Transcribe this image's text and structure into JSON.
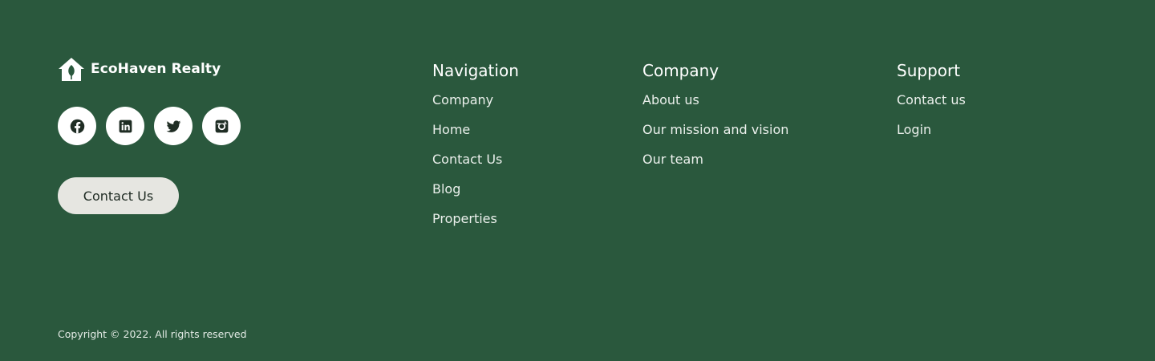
{
  "brand": {
    "name": "EcoHaven Realty",
    "logo_icon": "house-leaf-icon"
  },
  "social": [
    {
      "icon": "facebook-icon"
    },
    {
      "icon": "linkedin-icon"
    },
    {
      "icon": "twitter-icon"
    },
    {
      "icon": "instagram-icon"
    }
  ],
  "cta": {
    "label": "Contact Us"
  },
  "columns": {
    "navigation": {
      "title": "Navigation",
      "links": [
        "Company",
        "Home",
        "Contact Us",
        "Blog",
        "Properties"
      ]
    },
    "company": {
      "title": "Company",
      "links": [
        "About us",
        "Our mission and vision",
        "Our team"
      ]
    },
    "support": {
      "title": "Support",
      "links": [
        "Contact us",
        "Login"
      ]
    }
  },
  "copyright": "Copyright © 2022. All rights reserved",
  "colors": {
    "background": "#2a583d",
    "button_bg": "#e6e6e1",
    "text": "#ffffff"
  }
}
